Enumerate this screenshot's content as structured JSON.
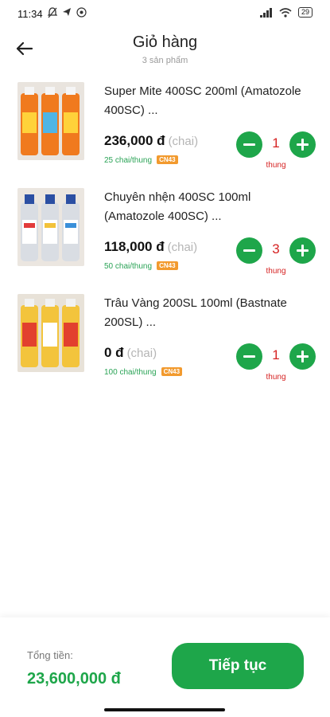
{
  "status_bar": {
    "time": "11:34",
    "battery": "29"
  },
  "header": {
    "title": "Giỏ hàng",
    "subtitle": "3 sản phẩm"
  },
  "items": [
    {
      "name": "Super Mite 400SC 200ml (Amatozole 400SC) ...",
      "price": "236,000 đ",
      "unit": "(chai)",
      "pack": "25 chai/thung",
      "badge": "CN43",
      "qty": "1",
      "qty_unit": "thung"
    },
    {
      "name": "Chuyên nhện 400SC 100ml (Amatozole 400SC) ...",
      "price": "118,000 đ",
      "unit": "(chai)",
      "pack": "50 chai/thung",
      "badge": "CN43",
      "qty": "3",
      "qty_unit": "thung"
    },
    {
      "name": "Trâu Vàng 200SL 100ml (Bastnate 200SL) ...",
      "price": "0 đ",
      "unit": "(chai)",
      "pack": "100 chai/thung",
      "badge": "CN43",
      "qty": "1",
      "qty_unit": "thung"
    }
  ],
  "footer": {
    "total_label": "Tổng tiền:",
    "total_value": "23,600,000 đ",
    "cta_label": "Tiếp tục"
  },
  "colors": {
    "accent": "#1ea64a",
    "qty": "#d62323",
    "badge": "#f29a2e"
  }
}
